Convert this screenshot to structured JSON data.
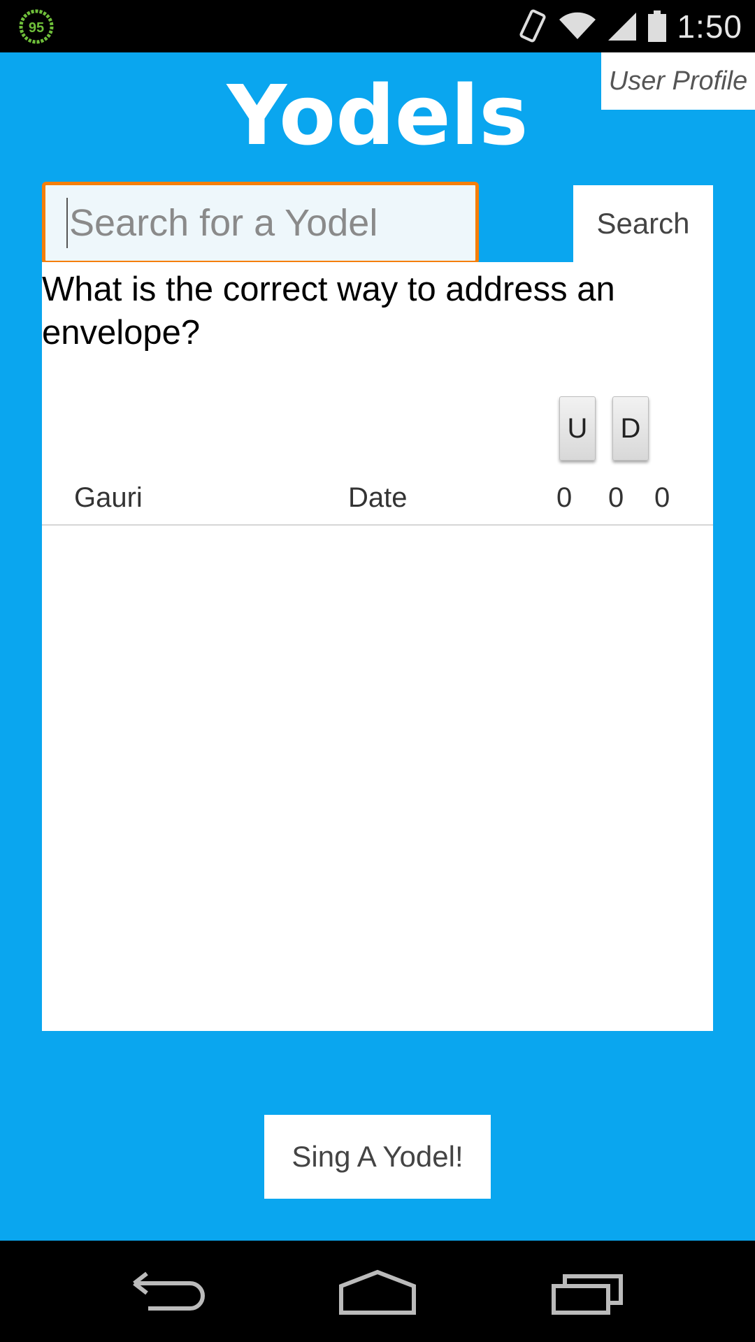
{
  "status_bar": {
    "battery_badge": "95",
    "time": "1:50",
    "icons": [
      "vibrate-icon",
      "wifi-icon",
      "signal-icon",
      "battery-icon"
    ]
  },
  "header": {
    "title": "Yodels",
    "user_profile_label": "User Profile"
  },
  "search": {
    "placeholder": "Search for a Yodel",
    "button_label": "Search"
  },
  "yodel": {
    "question": "What is the correct way to address an envelope?",
    "up_label": "U",
    "down_label": "D",
    "author": "Gauri",
    "date": "Date",
    "count_1": "0",
    "count_2": "0",
    "count_3": "0"
  },
  "actions": {
    "sing_label": "Sing A Yodel!"
  },
  "colors": {
    "app_background": "#0aa6ef",
    "search_focus_border": "#f57f0a",
    "panel": "#ffffff"
  },
  "nav_bar": {
    "icons": [
      "back-icon",
      "home-icon",
      "recent-apps-icon"
    ]
  }
}
